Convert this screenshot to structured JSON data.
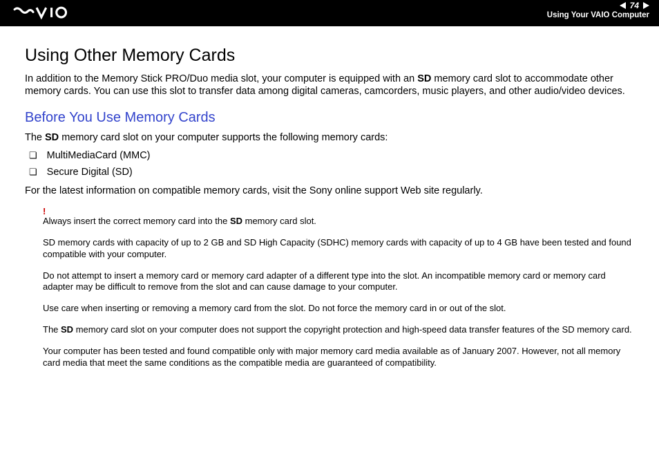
{
  "header": {
    "page_number": "74",
    "section": "Using Your VAIO Computer"
  },
  "content": {
    "title": "Using Other Memory Cards",
    "intro_pre": "In addition to the Memory Stick PRO/Duo media slot, your computer is equipped with an ",
    "intro_bold": "SD",
    "intro_post": " memory card slot to accommodate other memory cards. You can use this slot to transfer data among digital cameras, camcorders, music players, and other audio/video devices.",
    "subtitle": "Before You Use Memory Cards",
    "support_pre": "The ",
    "support_bold": "SD",
    "support_post": " memory card slot on your computer supports the following memory cards:",
    "list": [
      "MultiMediaCard (MMC)",
      "Secure Digital (SD)"
    ],
    "latest_info": "For the latest information on compatible memory cards, visit the Sony online support Web site regularly.",
    "warnings": {
      "w1_pre": "Always insert the correct memory card into the ",
      "w1_bold": "SD",
      "w1_post": " memory card slot.",
      "w2": "SD memory cards with capacity of up to 2 GB and SD High Capacity (SDHC) memory cards with capacity of up to 4 GB have been tested and found compatible with your computer.",
      "w3": "Do not attempt to insert a memory card or memory card adapter of a different type into the slot. An incompatible memory card or memory card adapter may be difficult to remove from the slot and can cause damage to your computer.",
      "w4": "Use care when inserting or removing a memory card from the slot. Do not force the memory card in or out of the slot.",
      "w5_pre": "The ",
      "w5_bold": "SD",
      "w5_post": " memory card slot on your computer does not support the copyright protection and high-speed data transfer features of the SD memory card.",
      "w6": "Your computer has been tested and found compatible only with major memory card media available as of January 2007. However, not all memory card media that meet the same conditions as the compatible media are guaranteed of compatibility."
    }
  }
}
